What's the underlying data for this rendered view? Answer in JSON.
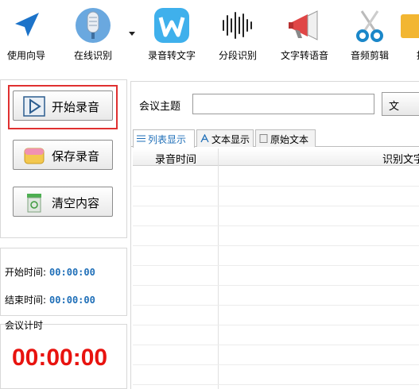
{
  "toolbar": {
    "items": [
      {
        "label": "使用向导",
        "icon": "navigation-arrow-icon"
      },
      {
        "label": "在线识别",
        "icon": "microphone-icon"
      },
      {
        "label": "录音转文字",
        "icon": "w-badge-icon"
      },
      {
        "label": "分段识别",
        "icon": "sound-wave-icon"
      },
      {
        "label": "文字转语音",
        "icon": "megaphone-icon"
      },
      {
        "label": "音频剪辑",
        "icon": "scissors-icon"
      },
      {
        "label": "提",
        "icon": "folder-icon"
      }
    ]
  },
  "left": {
    "start_record": "开始录音",
    "save_record": "保存录音",
    "clear_content": "清空内容",
    "start_time_label": "开始时间:",
    "start_time_value": "00:00:00",
    "end_time_label": "结束时间:",
    "end_time_value": "00:00:00",
    "meeting_timer_label": "会议计时",
    "meeting_timer_value": "00:00:00"
  },
  "main": {
    "topic_label": "会议主题",
    "topic_value": "",
    "topic_button": "文",
    "tabs": [
      {
        "label": "列表显示",
        "active": true
      },
      {
        "label": "文本显示",
        "active": false
      },
      {
        "label": "原始文本",
        "active": false
      }
    ],
    "columns": [
      "录音时间",
      "识别文字"
    ]
  },
  "colors": {
    "accent_blue": "#1f6fb8",
    "timer_red": "#e8130f",
    "focus_red": "#e03030"
  }
}
